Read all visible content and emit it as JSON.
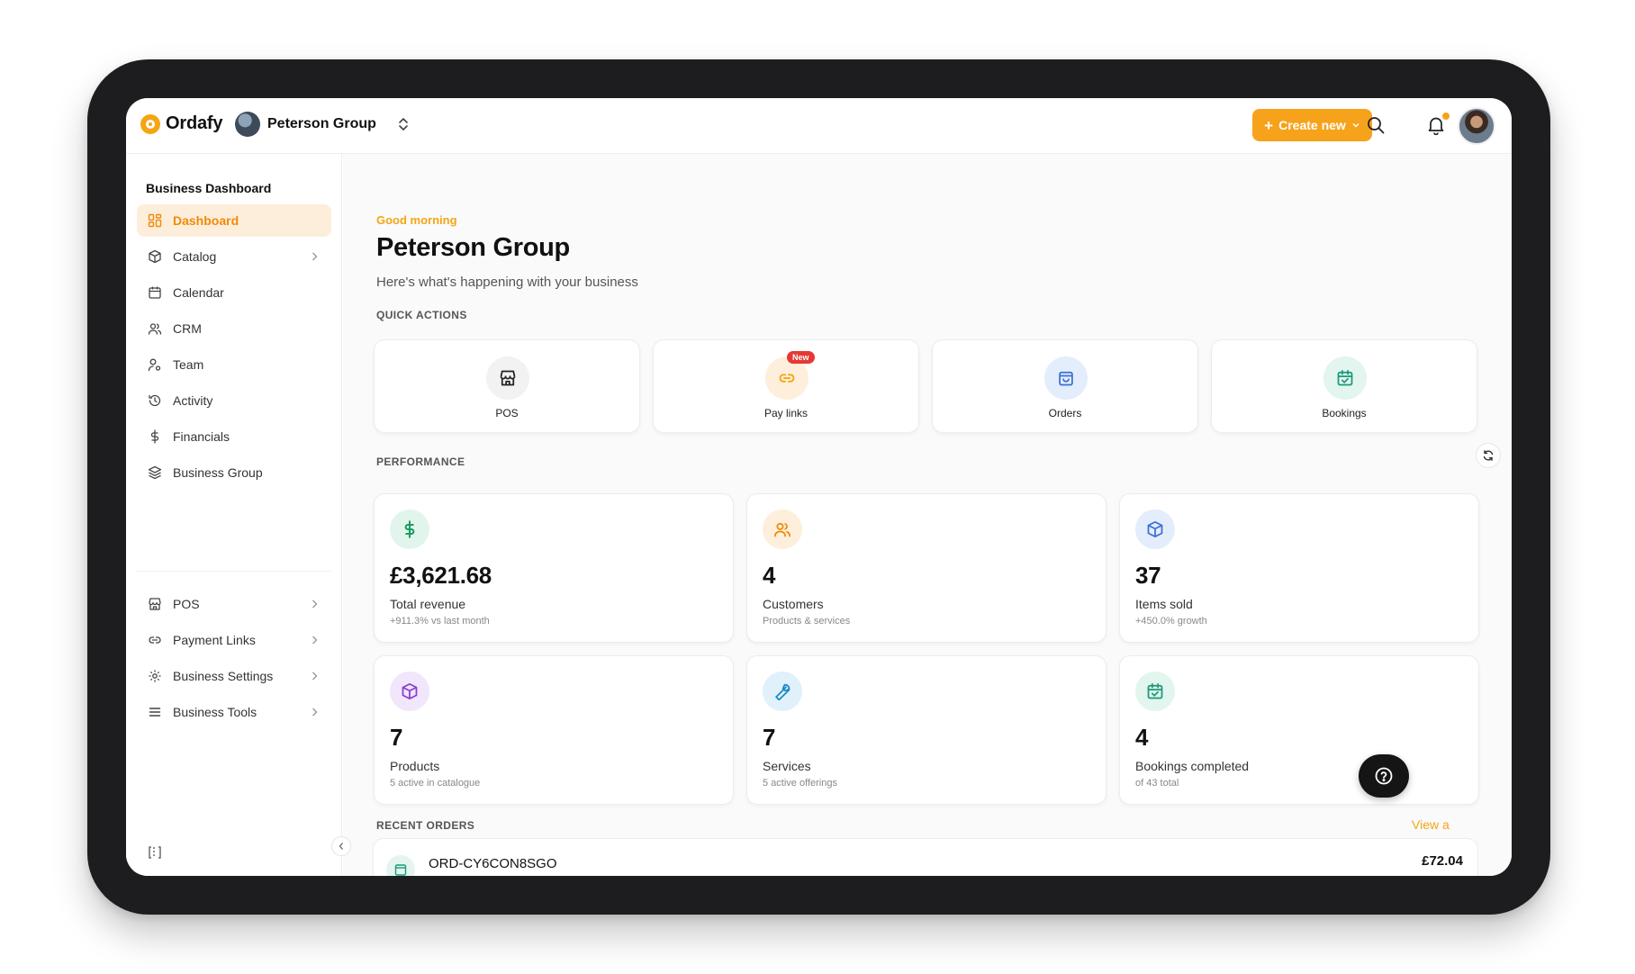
{
  "app": {
    "logo_text": "Ordafy",
    "org_name": "Peterson Group"
  },
  "header": {
    "create_label": "Create new"
  },
  "sidebar": {
    "title": "Business Dashboard",
    "items": [
      {
        "label": "Dashboard",
        "icon": "dashboard-icon",
        "active": true
      },
      {
        "label": "Catalog",
        "icon": "box-icon",
        "chevron": true
      },
      {
        "label": "Calendar",
        "icon": "calendar-icon"
      },
      {
        "label": "CRM",
        "icon": "users-icon"
      },
      {
        "label": "Team",
        "icon": "team-icon"
      },
      {
        "label": "Activity",
        "icon": "history-icon"
      },
      {
        "label": "Financials",
        "icon": "dollar-icon"
      },
      {
        "label": "Business Group",
        "icon": "layers-icon"
      }
    ],
    "items2": [
      {
        "label": "POS",
        "icon": "store-icon",
        "chevron": true
      },
      {
        "label": "Payment Links",
        "icon": "link-icon",
        "chevron": true
      },
      {
        "label": "Business Settings",
        "icon": "gear-icon",
        "chevron": true
      },
      {
        "label": "Business Tools",
        "icon": "menu-icon",
        "chevron": true
      }
    ]
  },
  "main": {
    "greeting": "Good morning",
    "title": "Peterson Group",
    "subtitle": "Here's what's happening with your business",
    "quick_actions_label": "QUICK ACTIONS",
    "quick_actions": [
      {
        "label": "POS",
        "icon": "store-icon",
        "bg": "#f2f2f2",
        "color": "#222222"
      },
      {
        "label": "Pay links",
        "icon": "link-icon",
        "bg": "#fdefdb",
        "color": "#f5a514",
        "badge": "New"
      },
      {
        "label": "Orders",
        "icon": "bag-icon",
        "bg": "#e4edfb",
        "color": "#3b6fd6"
      },
      {
        "label": "Bookings",
        "icon": "calendar-check-icon",
        "bg": "#e2f5ef",
        "color": "#1a9a78"
      }
    ],
    "performance_label": "PERFORMANCE",
    "stats": [
      {
        "value": "£3,621.68",
        "label": "Total revenue",
        "sub": "+911.3% vs last month",
        "icon": "dollar-icon",
        "bg": "#e2f5ec",
        "color": "#1a9a60"
      },
      {
        "value": "4",
        "label": "Customers",
        "sub": "Products & services",
        "icon": "users-icon",
        "bg": "#fdefdb",
        "color": "#f08a0a"
      },
      {
        "value": "37",
        "label": "Items sold",
        "sub": "+450.0% growth",
        "icon": "cube-icon",
        "bg": "#e4edfb",
        "color": "#3b6fd6"
      },
      {
        "value": "7",
        "label": "Products",
        "sub": "5 active in catalogue",
        "icon": "cube-icon",
        "bg": "#f1e6fb",
        "color": "#8a3fd1"
      },
      {
        "value": "7",
        "label": "Services",
        "sub": "5 active offerings",
        "icon": "wrench-icon",
        "bg": "#e0f1fb",
        "color": "#1b88c9"
      },
      {
        "value": "4",
        "label": "Bookings completed",
        "sub": "of 43 total",
        "icon": "calendar-check-icon",
        "bg": "#e2f5ef",
        "color": "#1a9a78"
      }
    ],
    "recent_orders_label": "RECENT ORDERS",
    "view_all": "View a",
    "orders": [
      {
        "id": "ORD-CY6CON8SGO",
        "amount": "£72.04"
      }
    ]
  }
}
